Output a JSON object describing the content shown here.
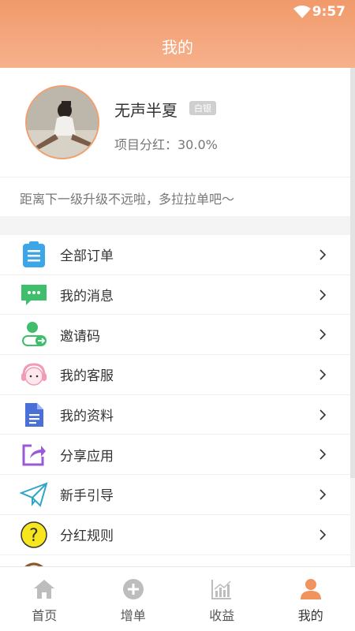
{
  "status": {
    "time": "9:57"
  },
  "header": {
    "title": "我的"
  },
  "profile": {
    "username": "无声半夏",
    "level": "白银",
    "share_rate": "项目分红：30.0%"
  },
  "notice": {
    "text": "距离下一级升级不远啦，多拉拉单吧～"
  },
  "menu": {
    "items": [
      {
        "label": "全部订单",
        "icon": "clipboard-icon"
      },
      {
        "label": "我的消息",
        "icon": "message-icon"
      },
      {
        "label": "邀请码",
        "icon": "invite-user-icon"
      },
      {
        "label": "我的客服",
        "icon": "headset-icon"
      },
      {
        "label": "我的资料",
        "icon": "document-icon"
      },
      {
        "label": "分享应用",
        "icon": "share-icon"
      },
      {
        "label": "新手引导",
        "icon": "paper-plane-icon"
      },
      {
        "label": "分红规则",
        "icon": "question-icon"
      }
    ]
  },
  "tabs": [
    {
      "label": "首页",
      "icon": "home-icon"
    },
    {
      "label": "增单",
      "icon": "add-circle-icon"
    },
    {
      "label": "收益",
      "icon": "chart-icon"
    },
    {
      "label": "我的",
      "icon": "user-icon"
    }
  ],
  "colors": {
    "accent": "#f19a6b",
    "active_tab": "#f0935f",
    "inactive_tab": "#bdbdbd"
  }
}
